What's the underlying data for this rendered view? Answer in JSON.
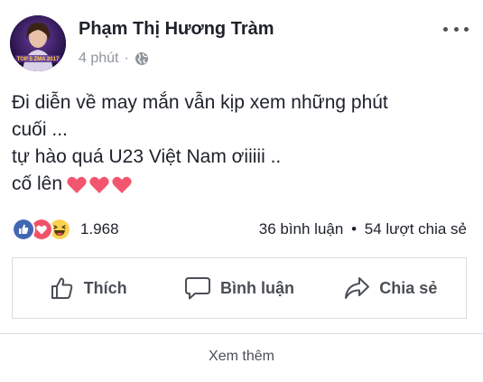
{
  "post": {
    "author": "Phạm Thị Hương Tràm",
    "time": "4 phút",
    "separator": "·",
    "text_lines": [
      "Đi diễn về may mắn vẫn kịp xem những phút",
      "cuối ...",
      "tự hào quá U23 Việt Nam ơiiiii ..",
      "cố lên"
    ],
    "emoji": [
      "red-heart",
      "red-heart",
      "red-heart"
    ],
    "avatar_text": "TOP 5 ZMA 2017"
  },
  "reactions": {
    "icons": [
      "like",
      "love",
      "haha"
    ],
    "count": "1.968",
    "comments": "36 bình luận",
    "bullet": "•",
    "shares": "54 lượt chia sẻ"
  },
  "actions": {
    "like_label": "Thích",
    "comment_label": "Bình luận",
    "share_label": "Chia sẻ"
  },
  "footer": {
    "see_more": "Xem thêm"
  },
  "colors": {
    "like_blue": "#4267b2",
    "love_red": "#f25268",
    "haha_yellow": "#fcd150",
    "heart_pink": "#f2566e",
    "meta_gray": "#90949c",
    "border_gray": "#dadde1"
  }
}
